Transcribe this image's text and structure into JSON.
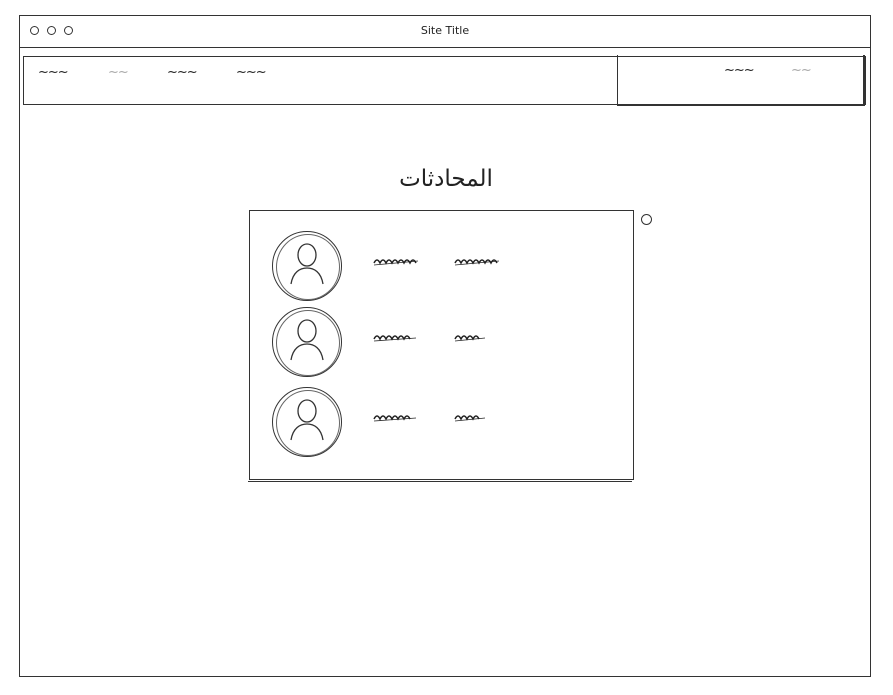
{
  "window": {
    "title": "Site Title"
  },
  "navbar": {
    "left_links": [
      {
        "label": "~~~",
        "active": true
      },
      {
        "label": "~~",
        "active": false
      },
      {
        "label": "~~~",
        "active": true
      },
      {
        "label": "~~~",
        "active": true
      }
    ],
    "right_links": [
      {
        "label": "~~~",
        "active": true
      },
      {
        "label": "~~",
        "active": false
      }
    ]
  },
  "main": {
    "heading": "المحادثات",
    "conversations": [
      {
        "avatar_icon": "user-avatar-icon"
      },
      {
        "avatar_icon": "user-avatar-icon"
      },
      {
        "avatar_icon": "user-avatar-icon"
      }
    ]
  },
  "colors": {
    "ink": "#222222",
    "muted": "#aaaaaa",
    "background": "#ffffff"
  }
}
